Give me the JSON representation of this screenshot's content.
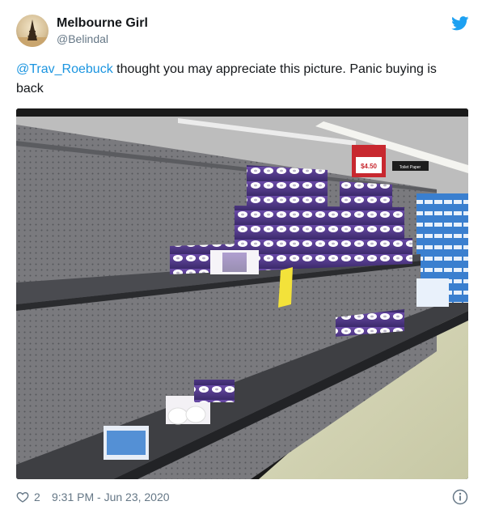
{
  "user": {
    "display_name": "Melbourne Girl",
    "handle": "@Belindal",
    "avatar_icon": "eiffel-tower-avatar"
  },
  "tweet": {
    "mention": "@Trav_Roebuck",
    "text": " thought you may appreciate this picture. Panic buying is back"
  },
  "media": {
    "icon": "supermarket-shelves-photo",
    "sign_price": "$4.50",
    "sign_label": "Toilet Paper"
  },
  "footer": {
    "like_count": "2",
    "timestamp": "9:31 PM - Jun 23, 2020"
  },
  "colors": {
    "twitter_blue": "#1da1f2",
    "mention": "#1b95e0",
    "secondary_text": "#657786"
  }
}
